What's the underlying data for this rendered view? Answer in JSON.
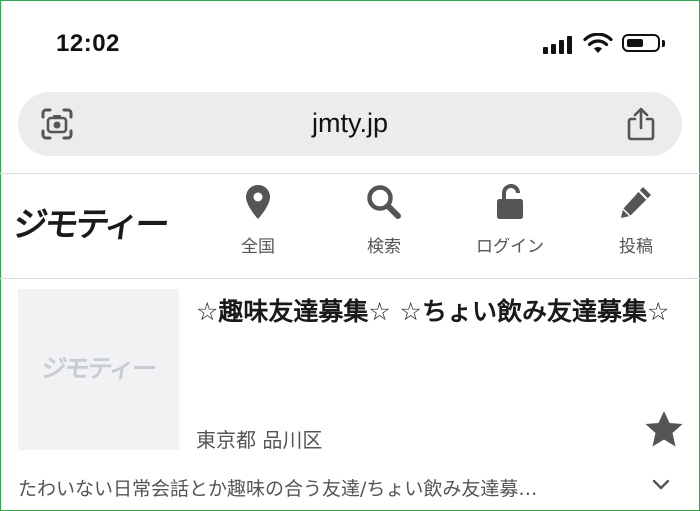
{
  "status_bar": {
    "time": "12:02"
  },
  "browser": {
    "url": "jmty.jp"
  },
  "site": {
    "logo": "ジモティー",
    "nav": [
      {
        "label": "全国",
        "icon": "location-pin-icon"
      },
      {
        "label": "検索",
        "icon": "search-icon"
      },
      {
        "label": "ログイン",
        "icon": "unlock-icon"
      },
      {
        "label": "投稿",
        "icon": "pencil-icon"
      }
    ]
  },
  "listing": {
    "thumbnail_logo": "ジモティー",
    "title": "☆趣味友達募集☆ ☆ちょい飲み友達募集☆",
    "location": "東京都 品川区",
    "description": "たわいない日常会話とか趣味の合う友達/ちょい飲み友達募…",
    "favorite_icon": "star-icon",
    "expand_icon": "chevron-down-icon"
  },
  "colors": {
    "frame_border": "#2fa84f",
    "url_bar": "#ececee",
    "thumbnail_bg": "#f1f2f4"
  }
}
